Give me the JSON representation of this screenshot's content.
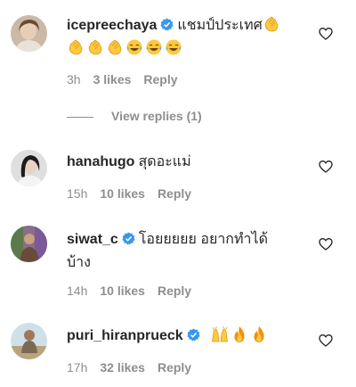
{
  "comments": [
    {
      "username": "icepreechaya",
      "verified": true,
      "text": "แชมป์ประเทศ",
      "emojis_line1": [
        "clapping-hands"
      ],
      "emojis_line2": [
        "clapping-hands",
        "clapping-hands",
        "clapping-hands",
        "tears-of-joy",
        "tears-of-joy",
        "tears-of-joy"
      ],
      "time": "3h",
      "likes": "3 likes",
      "reply": "Reply",
      "view_replies": "View replies (1)"
    },
    {
      "username": "hanahugo",
      "verified": false,
      "text": "สุดอะแม่",
      "time": "15h",
      "likes": "10 likes",
      "reply": "Reply"
    },
    {
      "username": "siwat_c",
      "verified": true,
      "text": "โอยยยยย อยากทำได้",
      "text_line2": "บ้าง",
      "time": "14h",
      "likes": "10 likes",
      "reply": "Reply"
    },
    {
      "username": "puri_hiranprueck",
      "verified": true,
      "text": "",
      "emojis": [
        "raising-hands",
        "fire",
        "fire"
      ],
      "time": "17h",
      "likes": "32 likes",
      "reply": "Reply"
    }
  ],
  "colors": {
    "text": "#262626",
    "muted": "#8e8e8e",
    "verified": "#3897f0",
    "emoji_yellow": "#FFC83D",
    "fire": "#F4900C"
  }
}
